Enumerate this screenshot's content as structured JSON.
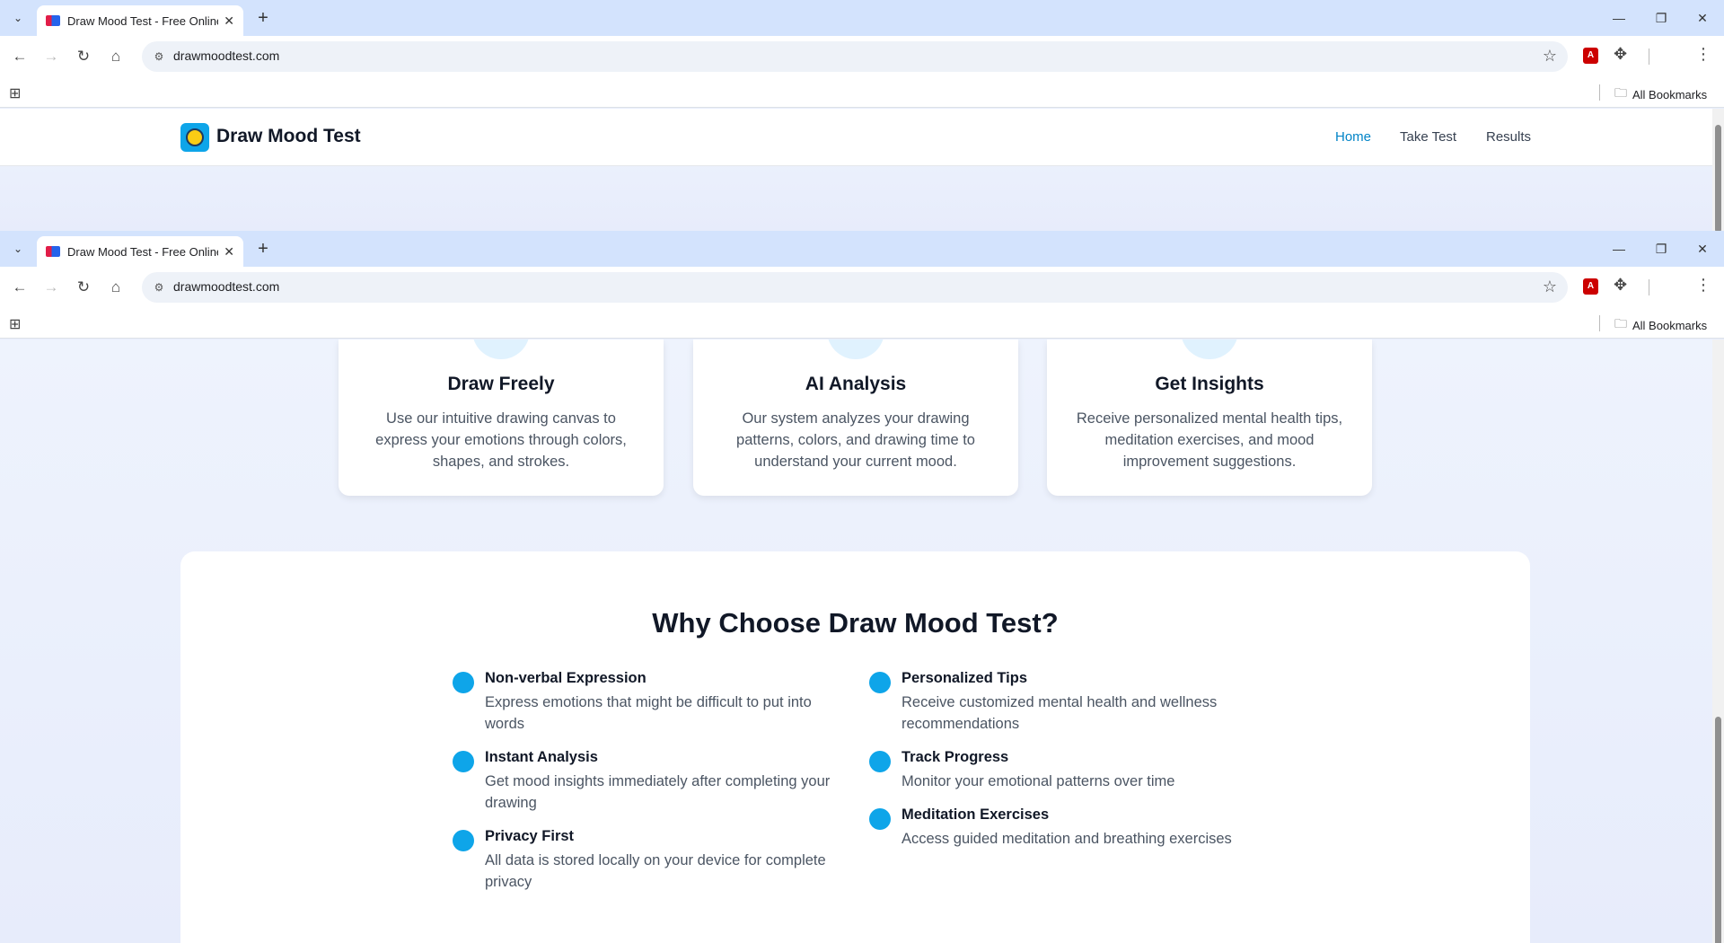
{
  "browser": {
    "tab_title": "Draw Mood Test - Free Online",
    "url": "drawmoodtest.com",
    "all_bookmarks": "All Bookmarks",
    "new_tab": "+",
    "close_tab": "✕",
    "minimize": "—",
    "restore": "❐",
    "close_window": "✕"
  },
  "header": {
    "brand": "Draw Mood Test",
    "nav": [
      "Home",
      "Take Test",
      "Results"
    ],
    "active_nav": "Home"
  },
  "cards": [
    {
      "title": "Draw Freely",
      "text": "Use our intuitive drawing canvas to express your emotions through colors, shapes, and strokes."
    },
    {
      "title": "AI Analysis",
      "text": "Our system analyzes your drawing patterns, colors, and drawing time to understand your current mood."
    },
    {
      "title": "Get Insights",
      "text": "Receive personalized mental health tips, meditation exercises, and mood improvement suggestions."
    }
  ],
  "why": {
    "heading": "Why Choose Draw Mood Test?",
    "left": [
      {
        "title": "Non-verbal Expression",
        "text": "Express emotions that might be difficult to put into words"
      },
      {
        "title": "Instant Analysis",
        "text": "Get mood insights immediately after completing your drawing"
      },
      {
        "title": "Privacy First",
        "text": "All data is stored locally on your device for complete privacy"
      }
    ],
    "right": [
      {
        "title": "Personalized Tips",
        "text": "Receive customized mental health and wellness recommendations"
      },
      {
        "title": "Track Progress",
        "text": "Monitor your emotional patterns over time"
      },
      {
        "title": "Meditation Exercises",
        "text": "Access guided meditation and breathing exercises"
      }
    ]
  },
  "colors": {
    "accent": "#0ea5e9",
    "active_link": "#0284c7",
    "tab_bar": "#d3e3fd"
  }
}
